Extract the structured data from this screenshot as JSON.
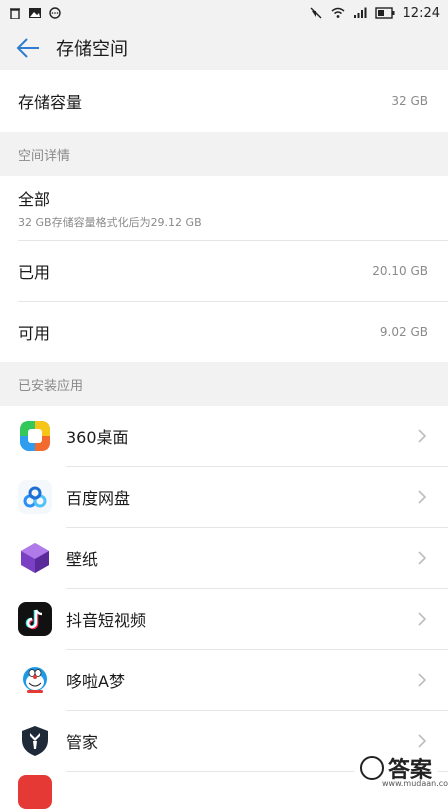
{
  "status": {
    "time": "12:24"
  },
  "appbar": {
    "title": "存储空间"
  },
  "capacity": {
    "label": "存储容量",
    "value": "32 GB"
  },
  "details": {
    "header": "空间详情",
    "all": {
      "label": "全部",
      "sub": "32 GB存储容量格式化后为29.12 GB"
    },
    "used": {
      "label": "已用",
      "value": "20.10 GB"
    },
    "free": {
      "label": "可用",
      "value": "9.02 GB"
    }
  },
  "apps": {
    "header": "已安装应用",
    "items": [
      {
        "name": "360桌面",
        "icon": "360-desktop-icon"
      },
      {
        "name": "百度网盘",
        "icon": "baidu-netdisk-icon"
      },
      {
        "name": "壁纸",
        "icon": "wallpaper-icon"
      },
      {
        "name": "抖音短视频",
        "icon": "douyin-icon"
      },
      {
        "name": "哆啦A梦",
        "icon": "doraemon-icon"
      },
      {
        "name": "管家",
        "icon": "manager-icon"
      }
    ]
  },
  "watermark": {
    "text": "答案",
    "url": "www.mudaan.com"
  },
  "colors": {
    "accent": "#2f7dd1",
    "background": "#f2f2f2"
  }
}
